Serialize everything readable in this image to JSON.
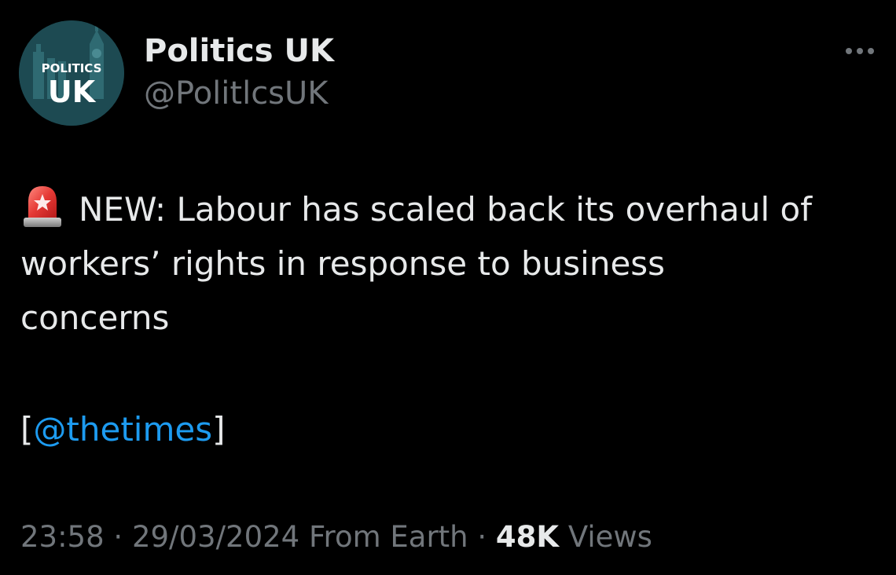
{
  "account": {
    "display_name": "Politics UK",
    "handle": "@PolitlcsUK",
    "avatar_text_top": "POLITICS",
    "avatar_text_bottom": "UK",
    "avatar_color": "#1d4a52"
  },
  "more_icon": "more-horizontal-icon",
  "tweet": {
    "emoji_icon": "rotating-light-icon",
    "line1": "NEW: Labour has scaled back its overhaul of",
    "line2": "workers’ rights in response to business",
    "line3": "concerns",
    "source_open": "[",
    "source_mention": "@thetimes",
    "source_close": "]"
  },
  "meta": {
    "time": "23:58",
    "sep1": "·",
    "date": "29/03/2024",
    "location": "From Earth",
    "sep2": "·",
    "views_count": "48K",
    "views_label": "Views"
  },
  "colors": {
    "background": "#000000",
    "text": "#e7e9ea",
    "secondary": "#71767b",
    "link": "#1d9bf0"
  }
}
